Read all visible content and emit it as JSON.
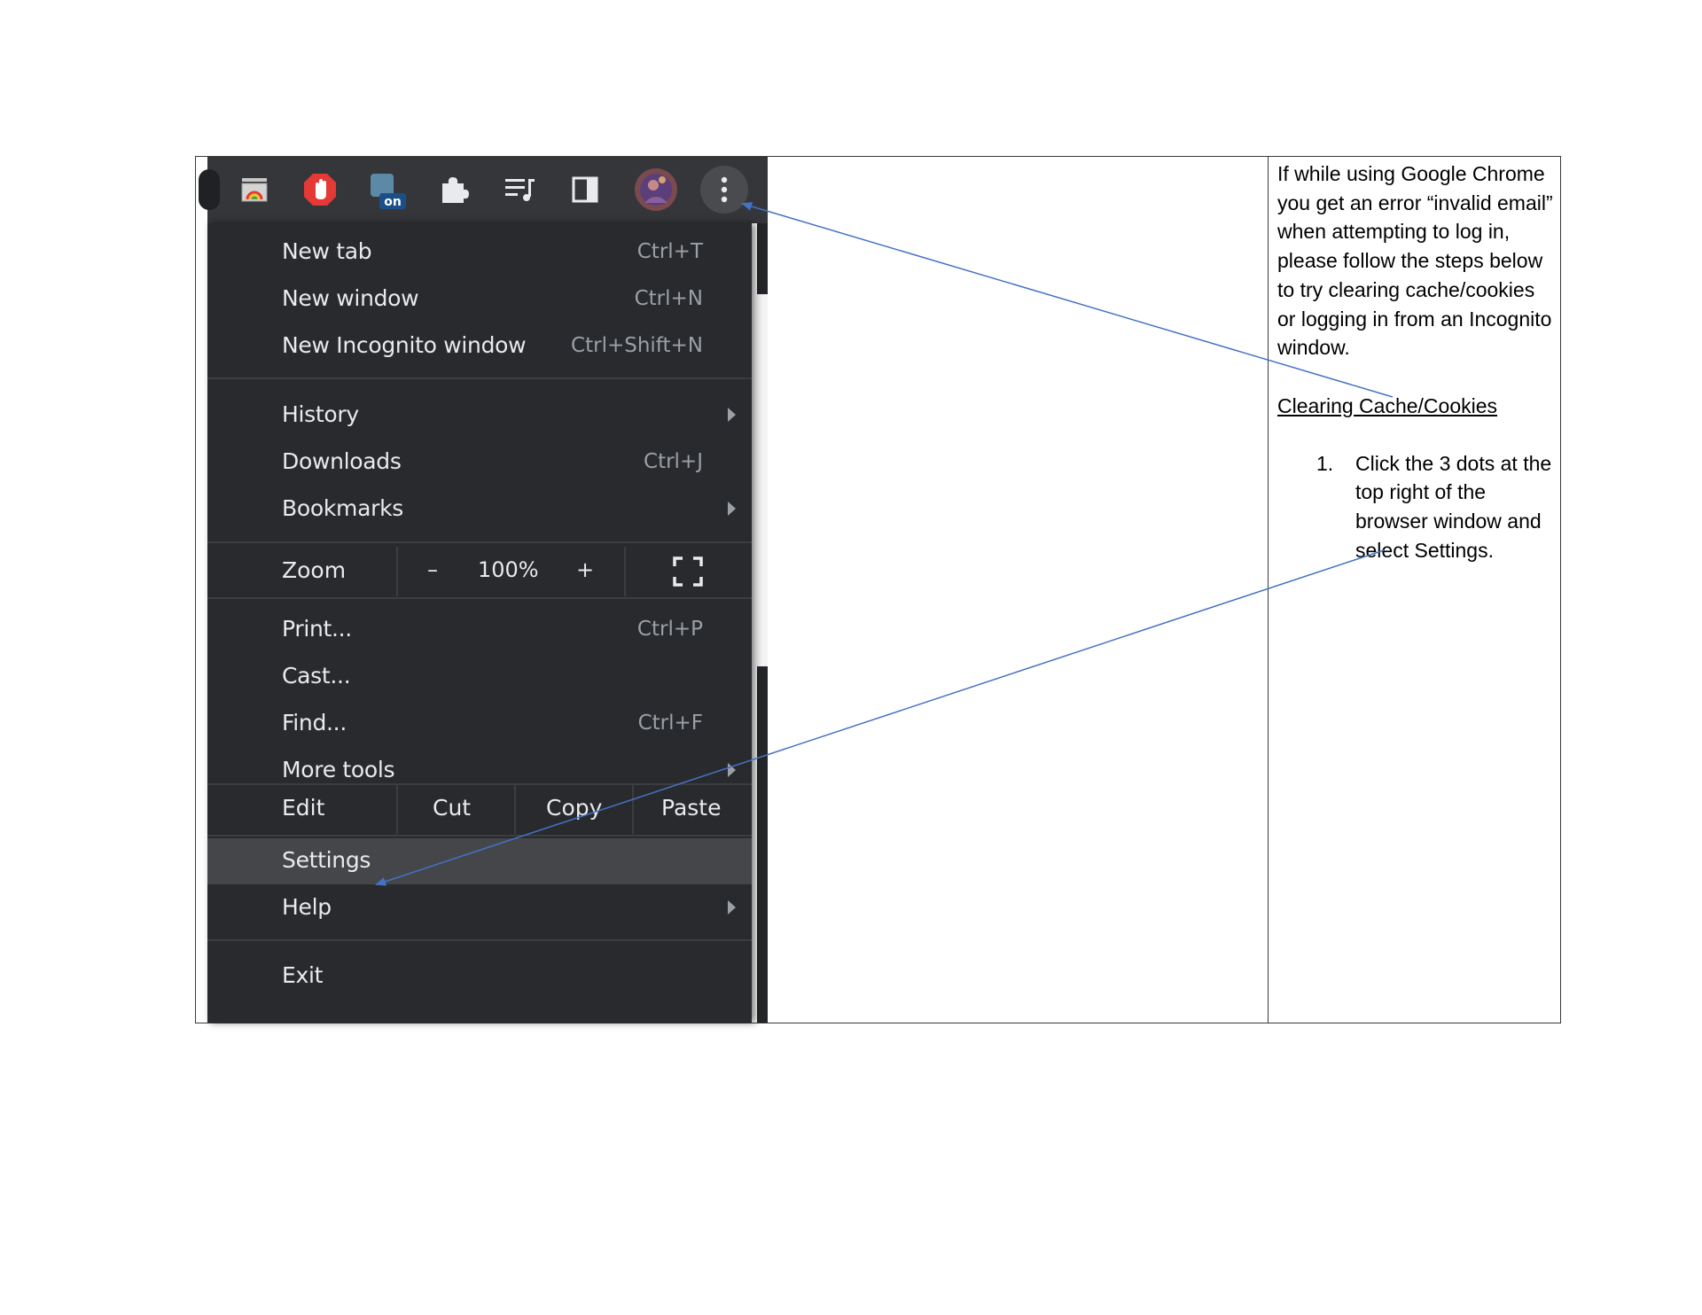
{
  "menu": {
    "new_tab": {
      "label": "New tab",
      "shortcut": "Ctrl+T"
    },
    "new_window": {
      "label": "New window",
      "shortcut": "Ctrl+N"
    },
    "new_incognito": {
      "label": "New Incognito window",
      "shortcut": "Ctrl+Shift+N"
    },
    "history": {
      "label": "History"
    },
    "downloads": {
      "label": "Downloads",
      "shortcut": "Ctrl+J"
    },
    "bookmarks": {
      "label": "Bookmarks"
    },
    "zoom": {
      "label": "Zoom",
      "minus": "–",
      "value": "100%",
      "plus": "+"
    },
    "print": {
      "label": "Print...",
      "shortcut": "Ctrl+P"
    },
    "cast": {
      "label": "Cast..."
    },
    "find": {
      "label": "Find...",
      "shortcut": "Ctrl+F"
    },
    "more_tools": {
      "label": "More tools"
    },
    "edit": {
      "label": "Edit",
      "cut": "Cut",
      "copy": "Copy",
      "paste": "Paste"
    },
    "settings": {
      "label": "Settings"
    },
    "help": {
      "label": "Help"
    },
    "exit": {
      "label": "Exit"
    }
  },
  "toolbar": {
    "badge_text": "on",
    "icons": [
      "tab-search-icon",
      "ad-block-hand-icon",
      "extension-on-badge-icon",
      "puzzle-extensions-icon",
      "media-playlist-icon",
      "side-panel-icon",
      "profile-avatar",
      "three-dots-menu-icon"
    ]
  },
  "instructions": {
    "intro": "If while using Google Chrome you get an error “invalid email” when attempting to log in, please follow the steps below to try clearing cache/cookies or logging in from an Incognito window.",
    "heading": "Clearing Cache/Cookies",
    "steps": [
      {
        "number": "1.",
        "text": "Click the 3 dots at the top right of the browser window and select Settings."
      }
    ]
  },
  "colors": {
    "menu_bg": "#292a2d",
    "menu_text": "#e8eaed",
    "shortcut_text": "#9aa0a6",
    "highlight": "#45464a",
    "arrow_line": "#4472c4"
  }
}
